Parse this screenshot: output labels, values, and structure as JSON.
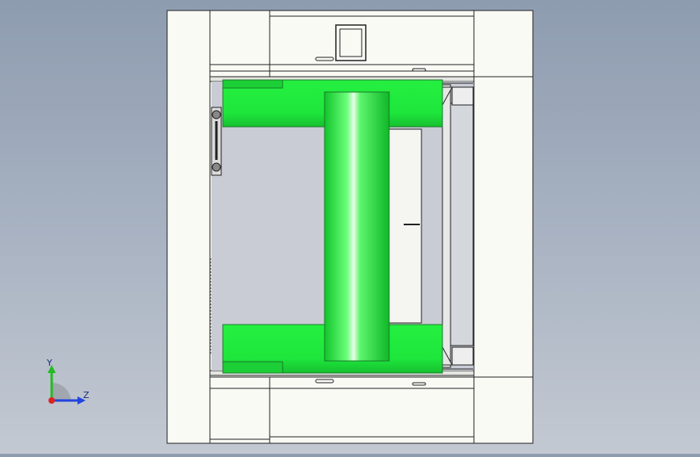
{
  "viewport": {
    "background_top": "#8e9cb0",
    "background_bottom": "#c3c9d2",
    "part_color": "#1ee63c",
    "frame_color": "#fafaf5",
    "edge_color": "#222222"
  },
  "triad": {
    "y_label": "Y",
    "z_label": "Z",
    "y_color": "#22bb22",
    "z_color": "#2244dd",
    "x_color": "#dd2222"
  }
}
